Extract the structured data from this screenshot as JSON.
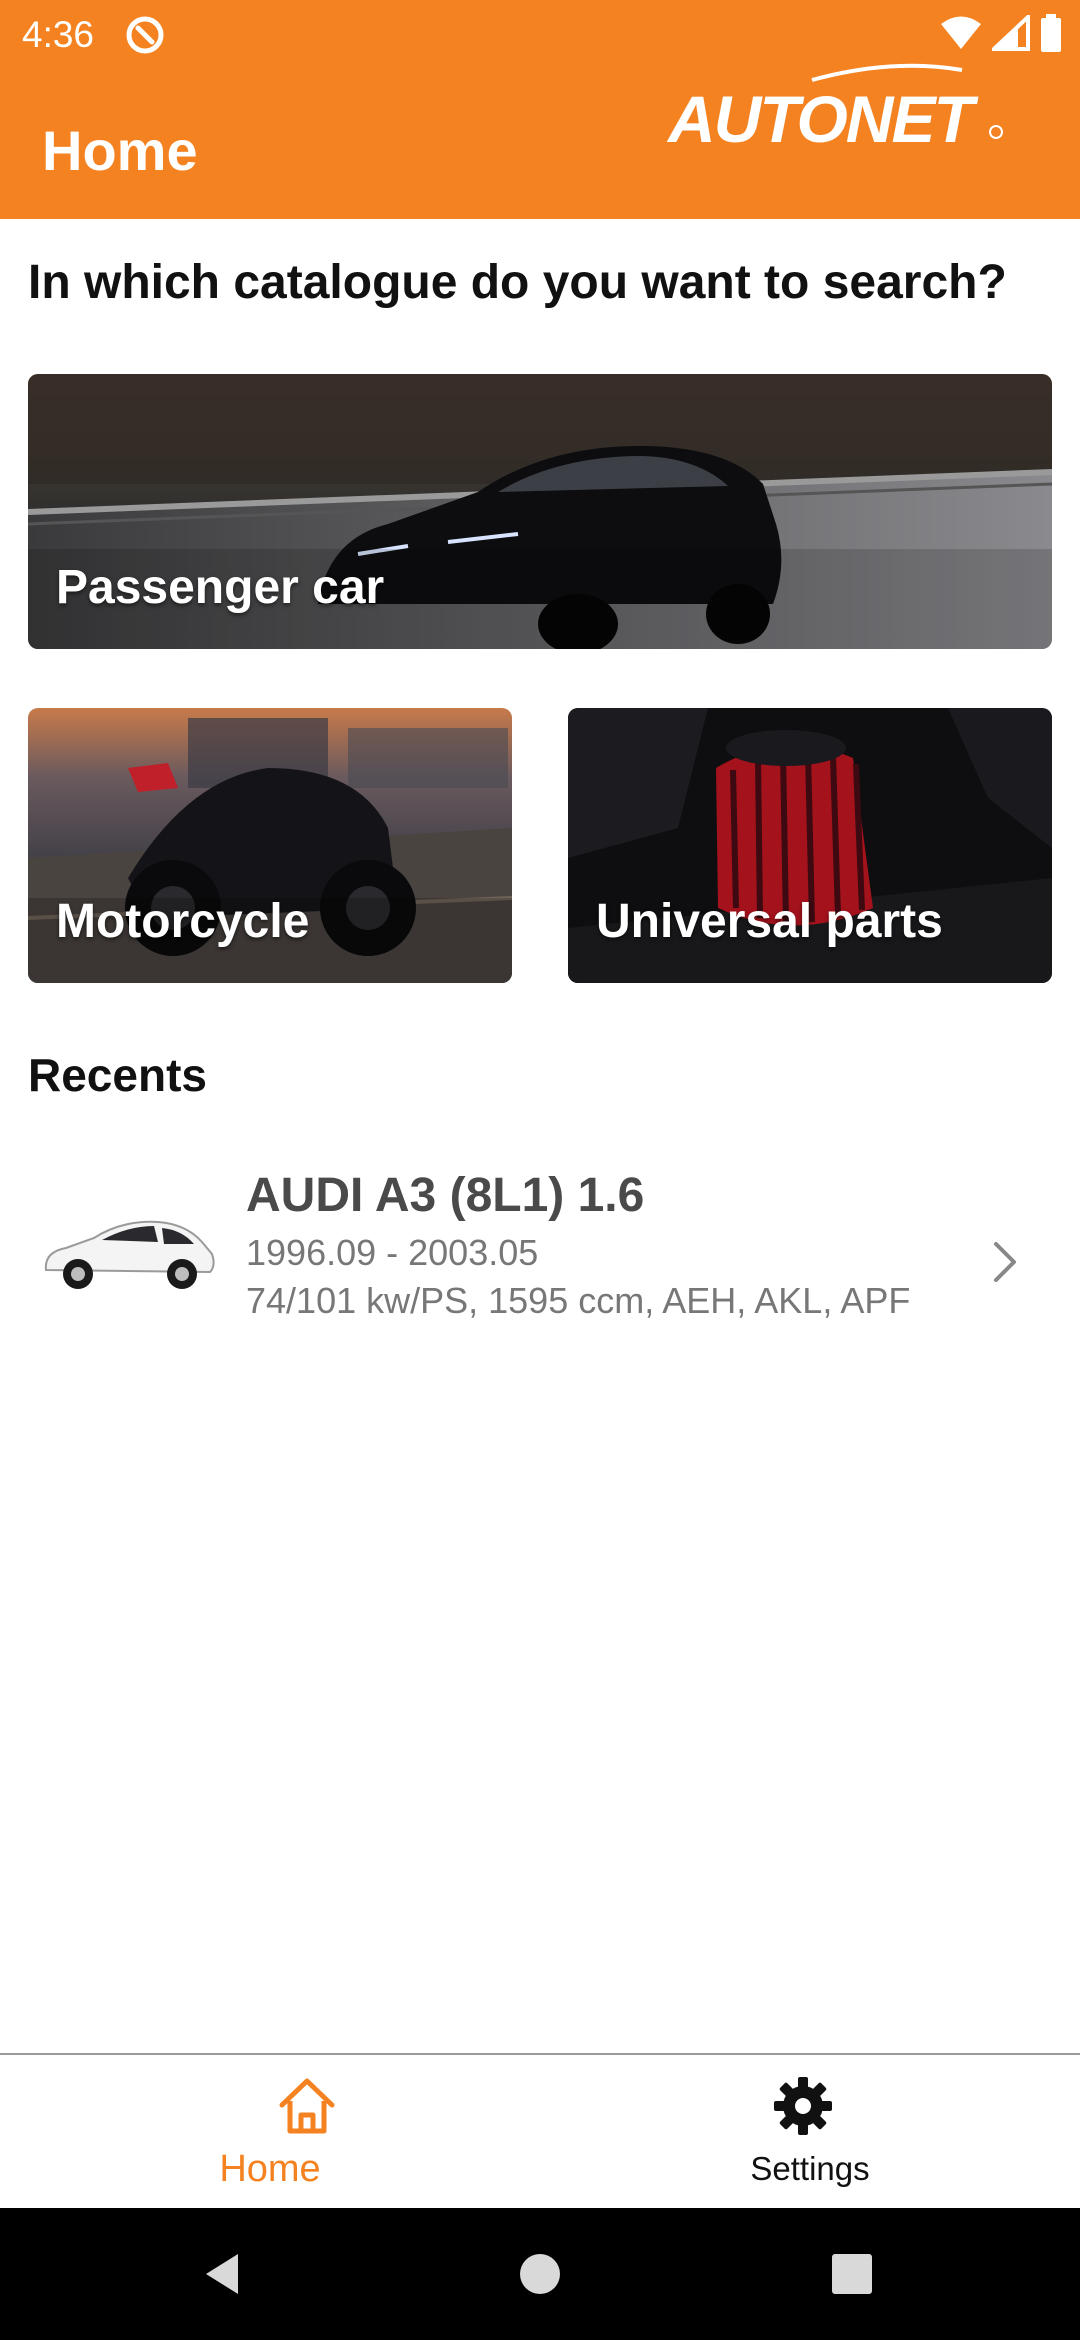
{
  "status_bar": {
    "time": "4:36",
    "icons": [
      "app-notification-icon",
      "wifi-icon",
      "signal-icon",
      "battery-icon"
    ]
  },
  "header": {
    "title": "Home",
    "brand": "AUTONET",
    "color": "#f58220"
  },
  "main": {
    "question": "In which catalogue do you want to search?",
    "catalogues": [
      {
        "label": "Passenger car"
      },
      {
        "label": "Motorcycle"
      },
      {
        "label": "Universal parts"
      }
    ],
    "recents_title": "Recents",
    "recents": [
      {
        "title": "AUDI A3 (8L1) 1.6",
        "dates": "1996.09 - 2003.05",
        "specs": "74/101 kw/PS, 1595 ccm, AEH, AKL, APF"
      }
    ]
  },
  "bottom_nav": {
    "items": [
      {
        "label": "Home",
        "icon": "home-icon",
        "active": true
      },
      {
        "label": "Settings",
        "icon": "gear-icon",
        "active": false
      }
    ],
    "active_color": "#f58220"
  },
  "system_nav": {
    "buttons": [
      "back-icon",
      "home-circle-icon",
      "recents-square-icon"
    ]
  }
}
